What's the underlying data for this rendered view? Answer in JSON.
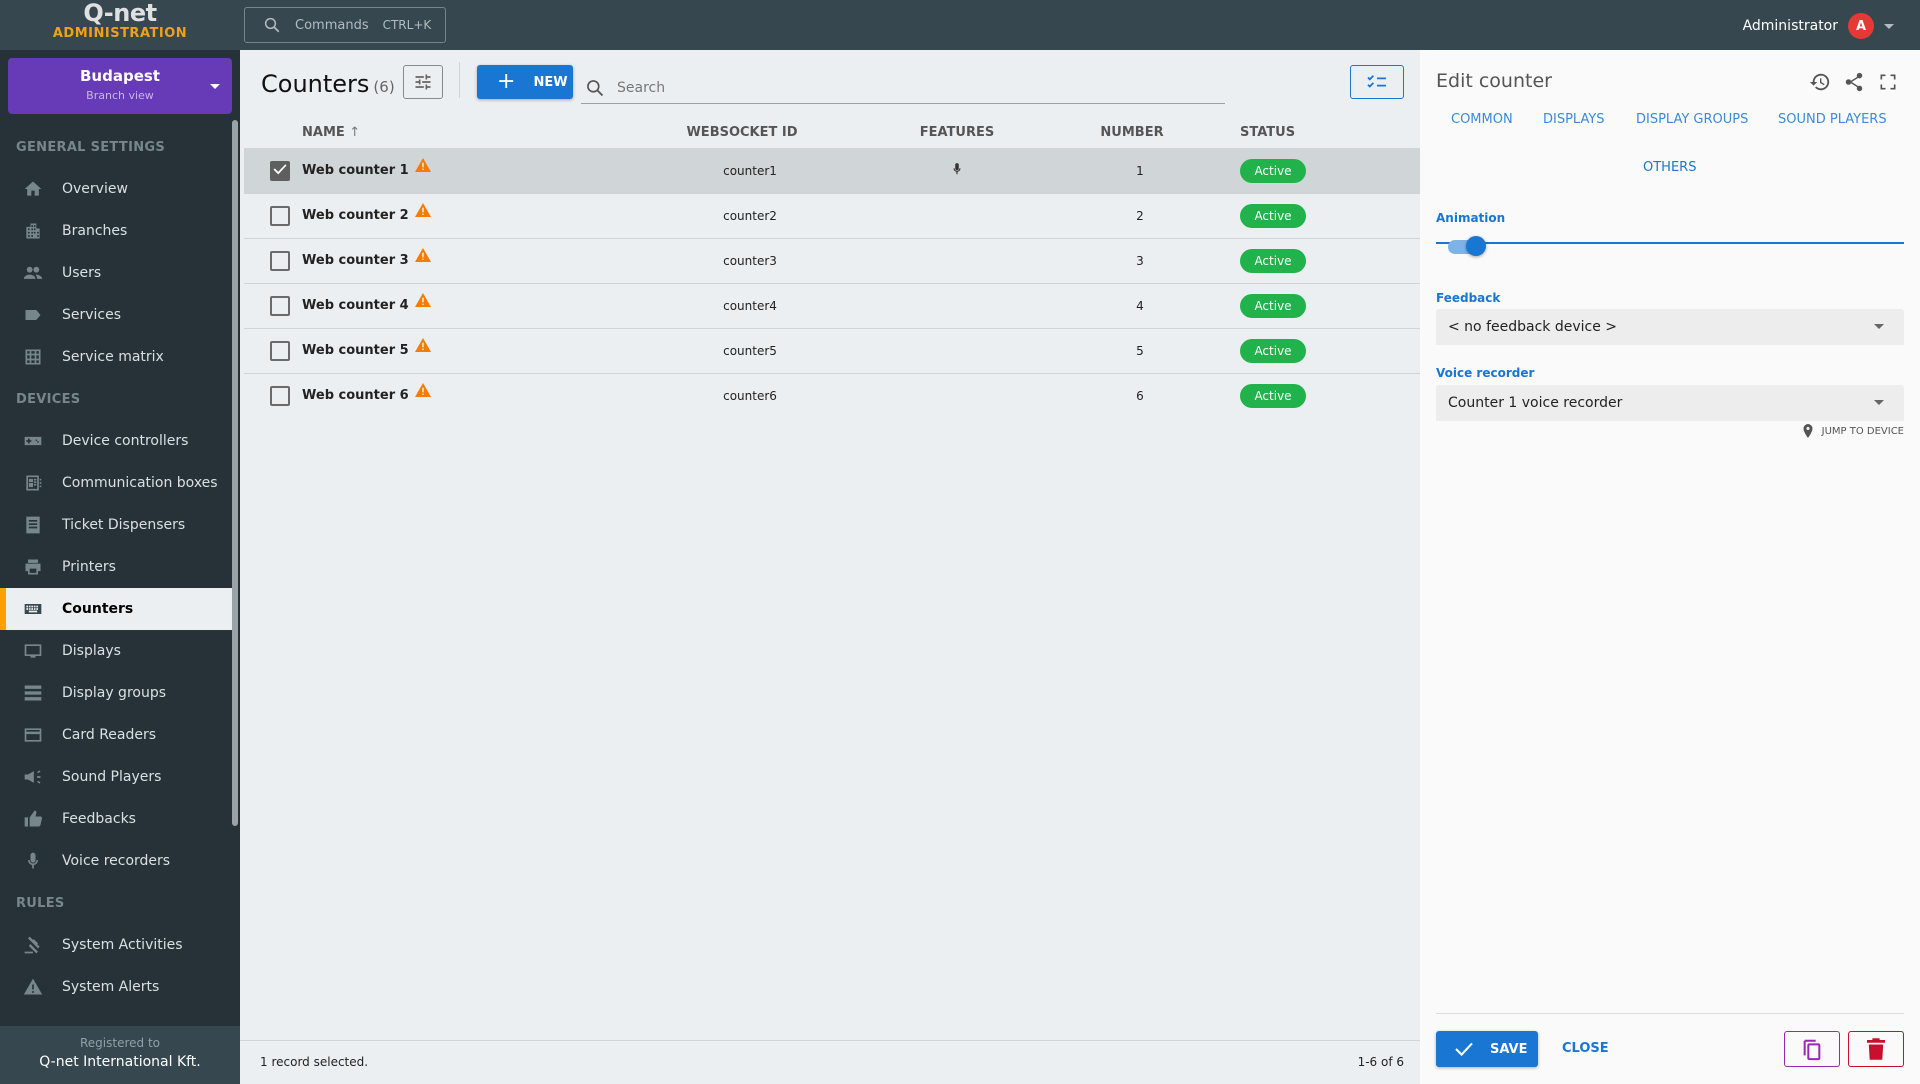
{
  "app": {
    "logo_text": "Q-net",
    "logo_subtitle": "ADMINISTRATION"
  },
  "topbar": {
    "commands_label": "Commands",
    "commands_shortcut": "CTRL+K",
    "user_name": "Administrator",
    "user_initial": "A"
  },
  "sidebar": {
    "branch_name": "Budapest",
    "branch_view": "Branch view",
    "sections": [
      {
        "title": "GENERAL SETTINGS",
        "items": [
          {
            "label": "Overview",
            "icon": "home-icon"
          },
          {
            "label": "Branches",
            "icon": "building-icon"
          },
          {
            "label": "Users",
            "icon": "users-icon"
          },
          {
            "label": "Services",
            "icon": "label-icon"
          },
          {
            "label": "Service matrix",
            "icon": "grid-icon"
          }
        ]
      },
      {
        "title": "DEVICES",
        "items": [
          {
            "label": "Device controllers",
            "icon": "gamepad-icon"
          },
          {
            "label": "Communication boxes",
            "icon": "chip-icon"
          },
          {
            "label": "Ticket Dispensers",
            "icon": "receipt-icon"
          },
          {
            "label": "Printers",
            "icon": "printer-icon"
          },
          {
            "label": "Counters",
            "icon": "keyboard-icon",
            "active": true
          },
          {
            "label": "Displays",
            "icon": "monitor-icon"
          },
          {
            "label": "Display groups",
            "icon": "stack-icon"
          },
          {
            "label": "Card Readers",
            "icon": "card-icon"
          },
          {
            "label": "Sound Players",
            "icon": "megaphone-icon"
          },
          {
            "label": "Feedbacks",
            "icon": "thumbs-up-icon"
          },
          {
            "label": "Voice recorders",
            "icon": "microphone-icon"
          }
        ]
      },
      {
        "title": "RULES",
        "items": [
          {
            "label": "System Activities",
            "icon": "gavel-icon"
          },
          {
            "label": "System Alerts",
            "icon": "warning-icon"
          }
        ]
      }
    ],
    "registered_label": "Registered to",
    "registered_company": "Q-net International Kft."
  },
  "main": {
    "title": "Counters",
    "count": "(6)",
    "new_label": "NEW",
    "search_placeholder": "Search",
    "columns": [
      "NAME",
      "WEBSOCKET ID",
      "FEATURES",
      "NUMBER",
      "STATUS"
    ],
    "rows": [
      {
        "name": "Web counter 1",
        "websocket_id": "counter1",
        "features": "microphone",
        "number": "1",
        "status": "Active",
        "selected": true,
        "warning": true
      },
      {
        "name": "Web counter 2",
        "websocket_id": "counter2",
        "features": "",
        "number": "2",
        "status": "Active",
        "selected": false,
        "warning": true
      },
      {
        "name": "Web counter 3",
        "websocket_id": "counter3",
        "features": "",
        "number": "3",
        "status": "Active",
        "selected": false,
        "warning": true
      },
      {
        "name": "Web counter 4",
        "websocket_id": "counter4",
        "features": "",
        "number": "4",
        "status": "Active",
        "selected": false,
        "warning": true
      },
      {
        "name": "Web counter 5",
        "websocket_id": "counter5",
        "features": "",
        "number": "5",
        "status": "Active",
        "selected": false,
        "warning": true
      },
      {
        "name": "Web counter 6",
        "websocket_id": "counter6",
        "features": "",
        "number": "6",
        "status": "Active",
        "selected": false,
        "warning": true
      }
    ],
    "footer_selected": "1 record selected.",
    "footer_range": "1-6 of 6"
  },
  "panel": {
    "title": "Edit counter",
    "tabs": [
      "COMMON",
      "DISPLAYS",
      "DISPLAY GROUPS",
      "SOUND PLAYERS",
      "OTHERS"
    ],
    "active_tab": "OTHERS",
    "animation_label": "Animation",
    "animation_on": true,
    "feedback_label": "Feedback",
    "feedback_value": "< no feedback device >",
    "voice_label": "Voice recorder",
    "voice_value": "Counter 1 voice recorder",
    "jump_label": "JUMP TO DEVICE",
    "save_label": "SAVE",
    "close_label": "CLOSE"
  },
  "colors": {
    "accent": "#1976d2",
    "branch": "#673ab7",
    "active_marker": "#ffa000",
    "status_active": "#22b24c",
    "warning": "#f57c00",
    "delete": "#c8102e",
    "copy": "#9c27b0"
  }
}
